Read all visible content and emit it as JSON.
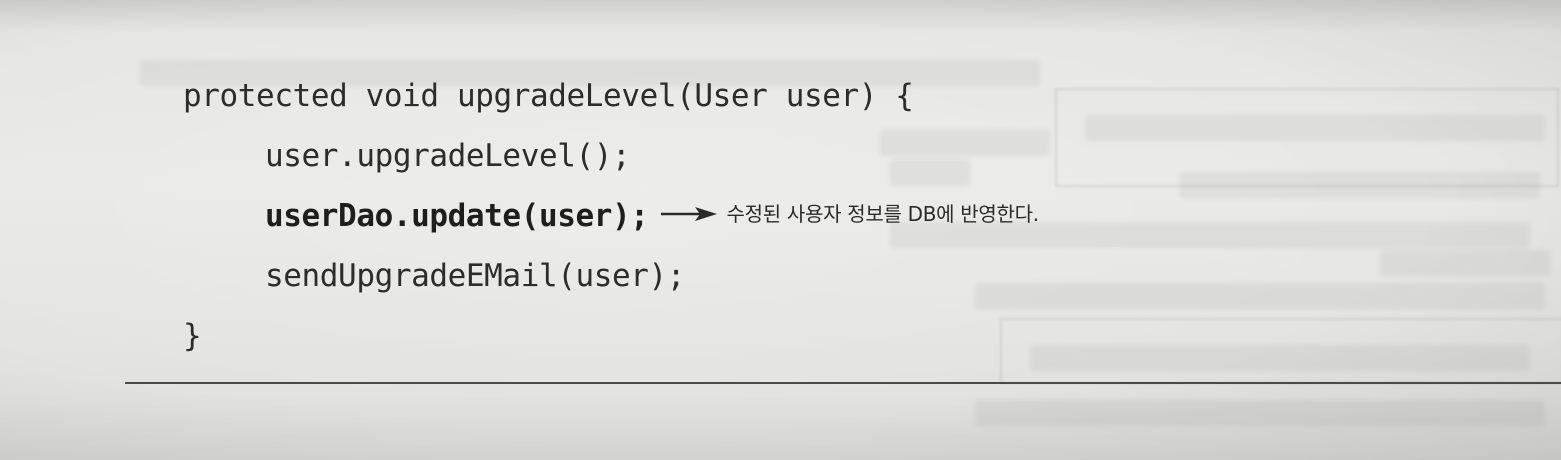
{
  "code": {
    "line1": "protected void upgradeLevel(User user) {",
    "line2": "user.upgradeLevel();",
    "line3": "userDao.update(user);",
    "line4": "sendUpgradeEMail(user);",
    "line5": "}"
  },
  "annotation": {
    "text": "수정된 사용자 정보를 DB에 반영한다."
  }
}
